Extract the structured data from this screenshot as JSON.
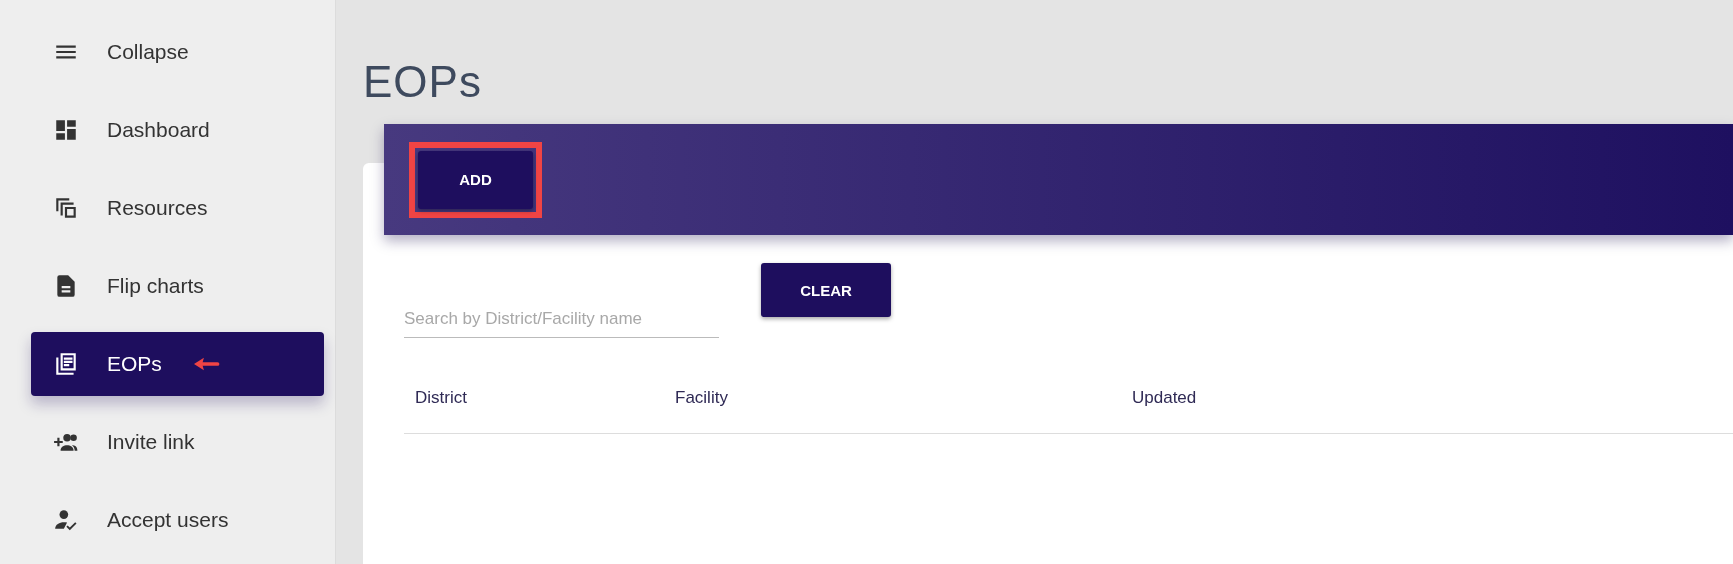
{
  "sidebar": {
    "items": [
      {
        "label": "Collapse",
        "selected": false,
        "pointed": false
      },
      {
        "label": "Dashboard",
        "selected": false,
        "pointed": false
      },
      {
        "label": "Resources",
        "selected": false,
        "pointed": false
      },
      {
        "label": "Flip charts",
        "selected": false,
        "pointed": false
      },
      {
        "label": "EOPs",
        "selected": true,
        "pointed": true
      },
      {
        "label": "Invite link",
        "selected": false,
        "pointed": false
      },
      {
        "label": "Accept users",
        "selected": false,
        "pointed": false
      }
    ]
  },
  "page": {
    "title": "EOPs"
  },
  "toolbar": {
    "add_button": {
      "label": "ADD",
      "highlighted": true
    }
  },
  "search": {
    "placeholder": "Search by District/Facility name"
  },
  "clear_button": {
    "label": "CLEAR"
  },
  "table": {
    "columns": [
      "District",
      "Facility",
      "Updated"
    ]
  }
}
